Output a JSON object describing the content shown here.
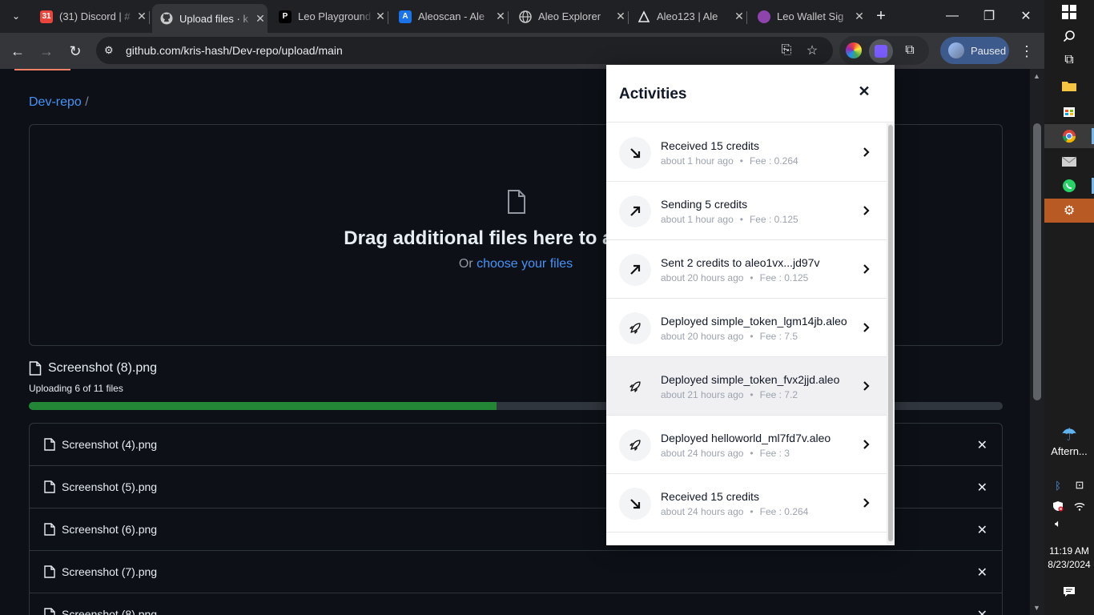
{
  "browser": {
    "tabs": [
      {
        "title": "(31) Discord | #",
        "favicon": "discord-icon",
        "fav_text": "31",
        "fav_color": "#e8453c"
      },
      {
        "title": "Upload files · k",
        "favicon": "github-icon",
        "fav_text": "",
        "fav_color": "#c8c8c8"
      },
      {
        "title": "Leo Playground",
        "favicon": "leo-playground-icon",
        "fav_text": "P",
        "fav_color": "#000000"
      },
      {
        "title": "Aleoscan - Ale",
        "favicon": "aleoscan-icon",
        "fav_text": "A",
        "fav_color": "#1a73e8"
      },
      {
        "title": "Aleo Explorer",
        "favicon": "globe-icon",
        "fav_text": "",
        "fav_color": "#9aa0a6"
      },
      {
        "title": "Aleo123 | Ale",
        "favicon": "aleo123-icon",
        "fav_text": "",
        "fav_color": "#000000"
      },
      {
        "title": "Leo Wallet Sig",
        "favicon": "leo-wallet-icon",
        "fav_text": "",
        "fav_color": "#8e44ad"
      }
    ],
    "url": "github.com/kris-hash/Dev-repo/upload/main",
    "profile_label": "Paused"
  },
  "page": {
    "breadcrumb_repo": "Dev-repo",
    "breadcrumb_sep": "/",
    "dropzone_title": "Drag additional files here to add them",
    "dropzone_or": "Or",
    "dropzone_link": "choose your files",
    "current_file": "Screenshot (8).png",
    "upload_status": "Uploading 6 of 11 files",
    "upload_progress_fraction": 0.48,
    "files": [
      {
        "name": "Screenshot (4).png"
      },
      {
        "name": "Screenshot (5).png"
      },
      {
        "name": "Screenshot (6).png"
      },
      {
        "name": "Screenshot (7).png"
      },
      {
        "name": "Screenshot (8).png"
      }
    ]
  },
  "wallet": {
    "title": "Activities",
    "items": [
      {
        "type": "receive",
        "title": "Received 15 credits",
        "time": "about 1 hour ago",
        "fee": "Fee : 0.264"
      },
      {
        "type": "send",
        "title": "Sending 5 credits",
        "time": "about 1 hour ago",
        "fee": "Fee : 0.125"
      },
      {
        "type": "send",
        "title": "Sent 2 credits to aleo1vx...jd97v",
        "time": "about 20 hours ago",
        "fee": "Fee : 0.125"
      },
      {
        "type": "deploy",
        "title": "Deployed simple_token_lgm14jb.aleo",
        "time": "about 20 hours ago",
        "fee": "Fee : 7.5"
      },
      {
        "type": "deploy",
        "title": "Deployed simple_token_fvx2jjd.aleo",
        "time": "about 21 hours ago",
        "fee": "Fee : 7.2"
      },
      {
        "type": "deploy",
        "title": "Deployed helloworld_ml7fd7v.aleo",
        "time": "about 24 hours ago",
        "fee": "Fee : 3"
      },
      {
        "type": "receive",
        "title": "Received 15 credits",
        "time": "about 24 hours ago",
        "fee": "Fee : 0.264"
      }
    ]
  },
  "taskbar": {
    "weather": "Aftern...",
    "time": "11:19 AM",
    "date": "8/23/2024"
  }
}
